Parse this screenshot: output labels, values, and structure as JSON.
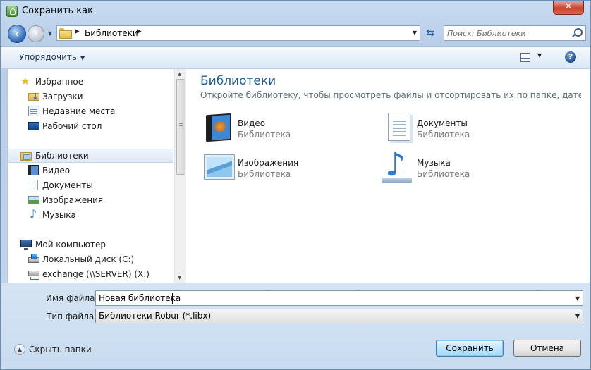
{
  "window": {
    "title": "Сохранить как",
    "close_label": "✕"
  },
  "address": {
    "path_label": "Библиотеки",
    "search_placeholder": "Поиск: Библиотеки"
  },
  "commandbar": {
    "organize_label": "Упорядочить",
    "help_label": "?"
  },
  "nav": {
    "favorites": {
      "header": "Избранное",
      "items": [
        "Загрузки",
        "Недавние места",
        "Рабочий стол"
      ]
    },
    "libraries": {
      "header": "Библиотеки",
      "items": [
        "Видео",
        "Документы",
        "Изображения",
        "Музыка"
      ]
    },
    "computer": {
      "header": "Мой компьютер",
      "items": [
        "Локальный диск (C:)",
        "exchange (\\\\SERVER) (X:)"
      ]
    }
  },
  "content": {
    "title": "Библиотеки",
    "subtitle": "Откройте библиотеку, чтобы просмотреть файлы и отсортировать их по папке, дате и други...",
    "libraries": [
      {
        "name": "Видео",
        "kind": "Библиотека",
        "icon": "video-library-icon"
      },
      {
        "name": "Документы",
        "kind": "Библиотека",
        "icon": "documents-library-icon"
      },
      {
        "name": "Изображения",
        "kind": "Библиотека",
        "icon": "pictures-library-icon"
      },
      {
        "name": "Музыка",
        "kind": "Библиотека",
        "icon": "music-library-icon"
      }
    ]
  },
  "form": {
    "filename_label": "Имя файла:",
    "filename_value": "Новая библиотека",
    "filetype_label": "Тип файла:",
    "filetype_value": "Библиотеки Robur (*.libx)",
    "hide_folders_label": "Скрыть папки",
    "save_label": "Сохранить",
    "cancel_label": "Отмена"
  },
  "colors": {
    "accent_title": "#1e5d93",
    "close_red": "#c8462b"
  }
}
